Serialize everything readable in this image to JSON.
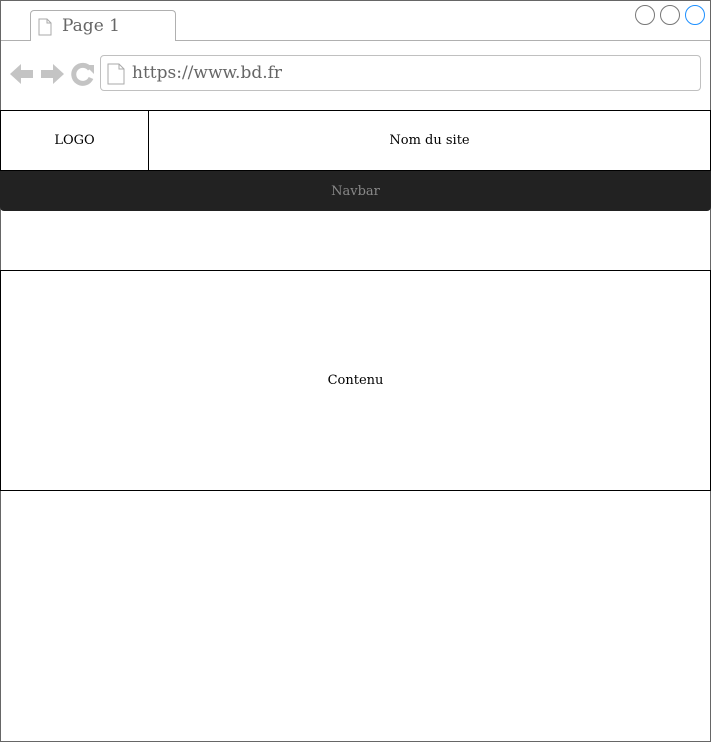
{
  "browser": {
    "tab_title": "Page 1",
    "url": "https://www.bd.fr",
    "accent_color": "#1e90ff"
  },
  "header": {
    "logo": "LOGO",
    "site_name": "Nom du site"
  },
  "navbar": {
    "label": "Navbar"
  },
  "main": {
    "content": "Contenu"
  }
}
